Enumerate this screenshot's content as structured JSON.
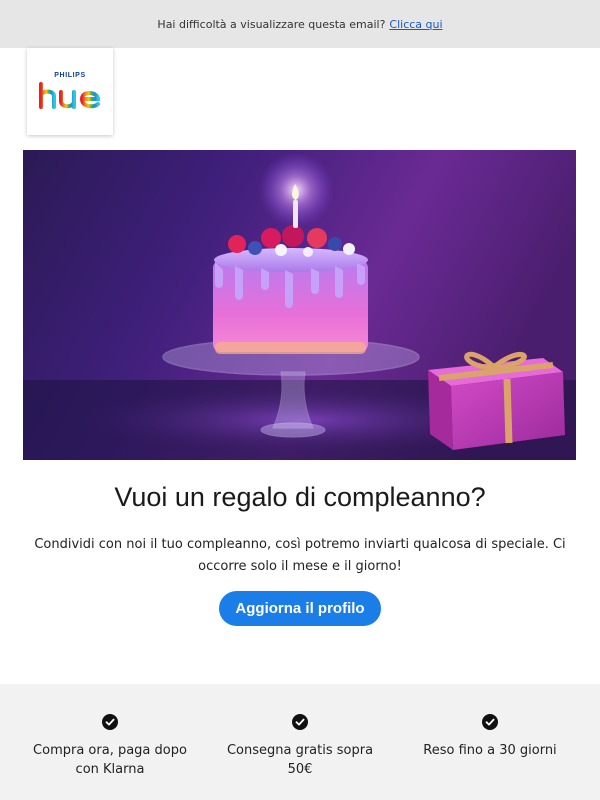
{
  "preheader": {
    "text": "Hai difficoltà a visualizzare questa email?",
    "link": "Clicca qui"
  },
  "logo": {
    "brand": "PHILIPS",
    "product": "hue"
  },
  "hero": {
    "icon": "birthday-cake-with-gift-illustration"
  },
  "main": {
    "headline": "Vuoi un regalo di compleanno?",
    "body": "Condividi con noi il tuo compleanno, così potremo inviarti qualcosa di speciale. Ci occorre solo il mese e il giorno!",
    "cta_label": "Aggiorna il profilo"
  },
  "benefits": [
    {
      "icon": "check-circle-icon",
      "label": "Compra ora, paga dopo con Klarna"
    },
    {
      "icon": "check-circle-icon",
      "label": "Consegna gratis sopra 50€"
    },
    {
      "icon": "check-circle-icon",
      "label": "Reso fino a 30 giorni"
    }
  ],
  "colors": {
    "cta": "#1a7de8",
    "link": "#1a56c8",
    "topbar": "#e6e6e6",
    "footer": "#f2f2f2"
  }
}
